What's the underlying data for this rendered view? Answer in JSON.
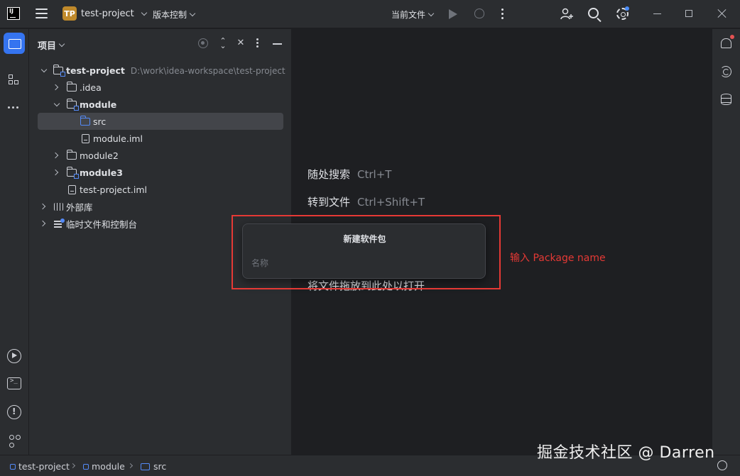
{
  "titlebar": {
    "logo_text": "IJ",
    "project_badge": "TP",
    "project_name": "test-project",
    "vcs_label": "版本控制",
    "run_config": "当前文件",
    "icons": [
      "menu-icon",
      "run-icon",
      "debug-icon",
      "more-icon",
      "add-user-icon",
      "search-icon",
      "settings-icon"
    ]
  },
  "project_panel": {
    "title": "项目",
    "tree": [
      {
        "label": "test-project",
        "path": "D:\\work\\idea-workspace\\test-project",
        "bold": true,
        "expanded": true,
        "icon": "module-folder-icon"
      },
      {
        "label": ".idea",
        "expanded": false,
        "icon": "folder-icon"
      },
      {
        "label": "module",
        "bold": true,
        "expanded": true,
        "icon": "module-folder-icon"
      },
      {
        "label": "src",
        "selected": true,
        "icon": "source-folder-icon"
      },
      {
        "label": "module.iml",
        "icon": "file-icon"
      },
      {
        "label": "module2",
        "expanded": false,
        "icon": "folder-icon"
      },
      {
        "label": "module3",
        "bold": true,
        "expanded": false,
        "icon": "module-folder-icon"
      },
      {
        "label": "test-project.iml",
        "icon": "file-icon"
      },
      {
        "label": "外部库",
        "expanded": false,
        "icon": "library-icon"
      },
      {
        "label": "临时文件和控制台",
        "expanded": false,
        "icon": "scratch-icon"
      }
    ]
  },
  "editor": {
    "hints": [
      {
        "label": "随处搜索",
        "shortcut": "Ctrl+T"
      },
      {
        "label": "转到文件",
        "shortcut": "Ctrl+Shift+T"
      }
    ],
    "drop_hint": "将文件拖放到此处以打开"
  },
  "popup": {
    "title": "新建软件包",
    "placeholder": "名称",
    "value": ""
  },
  "annotation": {
    "text": "输入 Package name",
    "color": "#e53935"
  },
  "statusbar": {
    "crumbs": [
      "test-project",
      "module",
      "src"
    ]
  },
  "watermark": "掘金技术社区 @ Darren",
  "colors": {
    "accent": "#3574f0",
    "background": "#1e1f22",
    "panel": "#2b2d30"
  }
}
